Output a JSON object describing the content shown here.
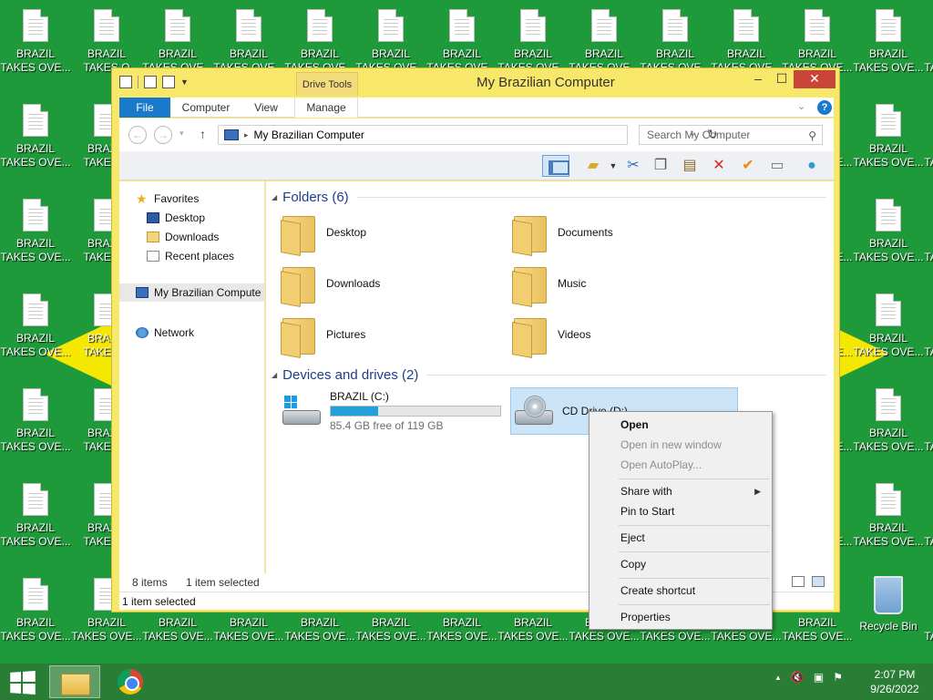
{
  "desktop": {
    "icon_label_line1": "BRAZIL",
    "icon_label_line2": "TAKES OVE...",
    "icon_label_line2_partial": "TAKES O",
    "recycle_bin": "Recycle Bin",
    "colors": {
      "background": "#1f9a3a",
      "diamond": "#f5e800"
    }
  },
  "window": {
    "title": "My Brazilian Computer",
    "context_tab_group": "Drive Tools",
    "tabs": [
      "File",
      "Computer",
      "View",
      "Manage"
    ],
    "address": "My Brazilian Computer",
    "search_placeholder": "Search My Computer",
    "nav": {
      "favorites": "Favorites",
      "desktop": "Desktop",
      "downloads": "Downloads",
      "recent": "Recent places",
      "computer": "My Brazilian Compute",
      "network": "Network"
    },
    "sections": {
      "folders": "Folders (6)",
      "devices": "Devices and drives (2)"
    },
    "folders": [
      "Desktop",
      "Documents",
      "Downloads",
      "Music",
      "Pictures",
      "Videos"
    ],
    "drives": [
      {
        "name": "BRAZIL (C:)",
        "free": "85.4 GB free of 119 GB",
        "used_fraction": 0.28
      },
      {
        "name": "CD Drive (D:)"
      }
    ],
    "status": {
      "items": "8 items",
      "selected": "1 item selected",
      "bar": "1 item selected"
    }
  },
  "context_menu": {
    "open": "Open",
    "open_new_window": "Open in new window",
    "open_autoplay": "Open AutoPlay...",
    "share_with": "Share with",
    "pin_to_start": "Pin to Start",
    "eject": "Eject",
    "copy": "Copy",
    "create_shortcut": "Create shortcut",
    "properties": "Properties"
  },
  "taskbar": {
    "time": "2:07 PM",
    "date": "9/26/2022"
  }
}
